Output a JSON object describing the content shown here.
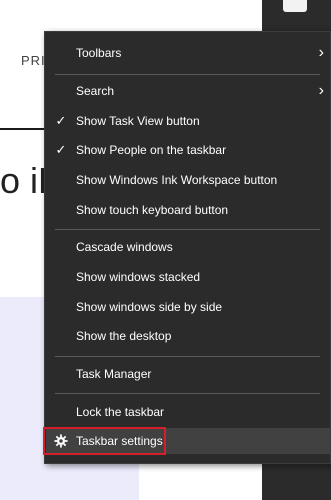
{
  "background": {
    "header_text": "PRIV",
    "heading_text": "o iP"
  },
  "menu": {
    "items": [
      {
        "label": "Toolbars",
        "submenu": true
      },
      {
        "label": "Search",
        "submenu": true
      },
      {
        "label": "Show Task View button",
        "checked": true
      },
      {
        "label": "Show People on the taskbar",
        "checked": true
      },
      {
        "label": "Show Windows Ink Workspace button"
      },
      {
        "label": "Show touch keyboard button"
      },
      {
        "label": "Cascade windows"
      },
      {
        "label": "Show windows stacked"
      },
      {
        "label": "Show windows side by side"
      },
      {
        "label": "Show the desktop"
      },
      {
        "label": "Task Manager"
      },
      {
        "label": "Lock the taskbar"
      },
      {
        "label": "Taskbar settings",
        "icon": "gear-icon",
        "highlighted": true
      }
    ],
    "check_glyph": "✓",
    "submenu_glyph": "›"
  },
  "colors": {
    "menu_bg": "#2b2b2b",
    "menu_text": "#ffffff",
    "highlight_border": "#d4202a"
  }
}
